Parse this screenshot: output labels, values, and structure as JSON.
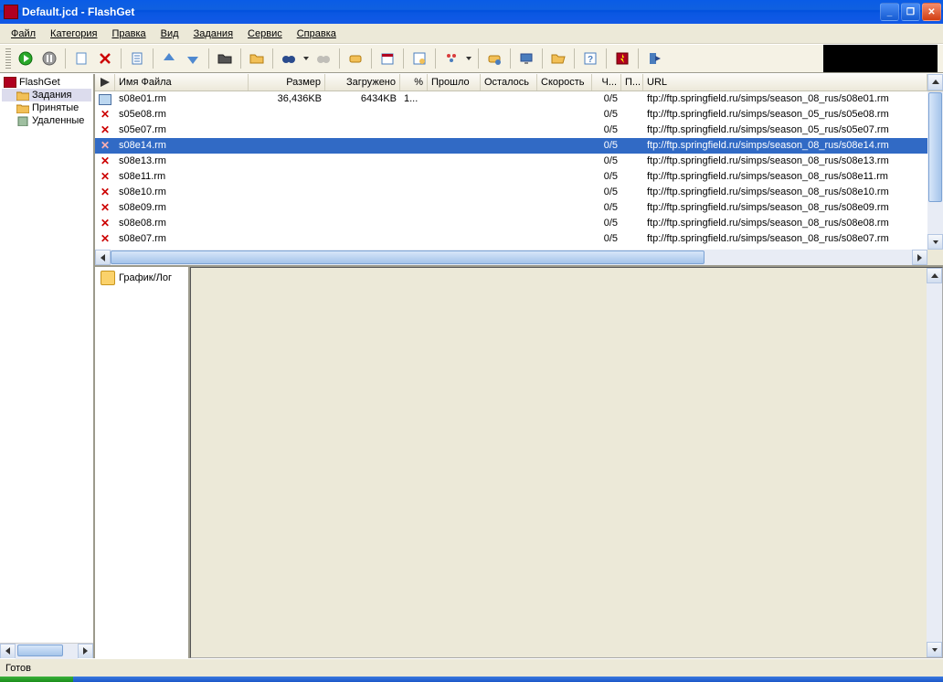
{
  "title": "Default.jcd - FlashGet",
  "menu": {
    "file": "Файл",
    "category": "Категория",
    "edit": "Правка",
    "view": "Вид",
    "tasks": "Задания",
    "service": "Сервис",
    "help": "Справка"
  },
  "sidebar": {
    "root": "FlashGet",
    "tasks": "Задания",
    "received": "Принятые",
    "deleted": "Удаленные"
  },
  "columns": {
    "name": "Имя Файла",
    "size": "Размер",
    "loaded": "Загружено",
    "percent": "%",
    "elapsed": "Прошло",
    "left": "Осталось",
    "speed": "Скорость",
    "parts": "Ч...",
    "priority": "П...",
    "url": "URL"
  },
  "rows": [
    {
      "status": "progress",
      "name": "s08e01.rm",
      "size": "36,436KB",
      "loaded": "6434KB",
      "percent": "1...",
      "parts": "0/5",
      "url": "ftp://ftp.springfield.ru/simps/season_08_rus/s08e01.rm"
    },
    {
      "status": "error",
      "name": "s05e08.rm",
      "parts": "0/5",
      "url": "ftp://ftp.springfield.ru/simps/season_05_rus/s05e08.rm"
    },
    {
      "status": "error",
      "name": "s05e07.rm",
      "parts": "0/5",
      "url": "ftp://ftp.springfield.ru/simps/season_05_rus/s05e07.rm"
    },
    {
      "status": "error",
      "name": "s08e14.rm",
      "parts": "0/5",
      "url": "ftp://ftp.springfield.ru/simps/season_08_rus/s08e14.rm",
      "selected": true
    },
    {
      "status": "error",
      "name": "s08e13.rm",
      "parts": "0/5",
      "url": "ftp://ftp.springfield.ru/simps/season_08_rus/s08e13.rm"
    },
    {
      "status": "error",
      "name": "s08e11.rm",
      "parts": "0/5",
      "url": "ftp://ftp.springfield.ru/simps/season_08_rus/s08e11.rm"
    },
    {
      "status": "error",
      "name": "s08e10.rm",
      "parts": "0/5",
      "url": "ftp://ftp.springfield.ru/simps/season_08_rus/s08e10.rm"
    },
    {
      "status": "error",
      "name": "s08e09.rm",
      "parts": "0/5",
      "url": "ftp://ftp.springfield.ru/simps/season_08_rus/s08e09.rm"
    },
    {
      "status": "error",
      "name": "s08e08.rm",
      "parts": "0/5",
      "url": "ftp://ftp.springfield.ru/simps/season_08_rus/s08e08.rm"
    },
    {
      "status": "error",
      "name": "s08e07.rm",
      "parts": "0/5",
      "url": "ftp://ftp.springfield.ru/simps/season_08_rus/s08e07.rm"
    }
  ],
  "infoTab": "График/Лог",
  "statusbar": "Готов"
}
